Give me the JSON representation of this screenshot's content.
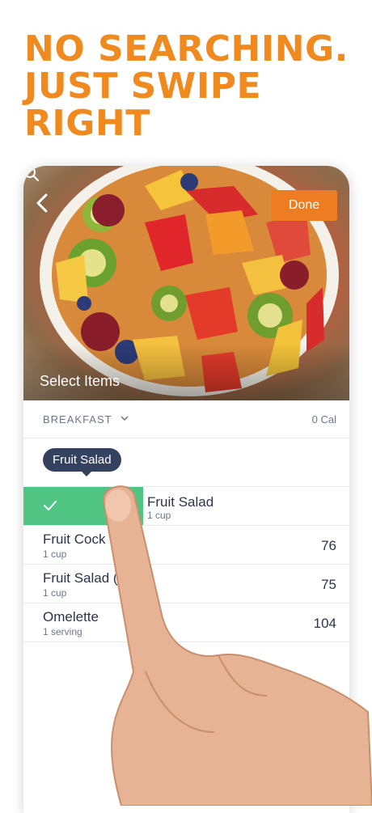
{
  "headline": {
    "line1": "NO SEARCHING.",
    "line2": "JUST SWIPE",
    "line3": "RIGHT",
    "color": "#f08a1f"
  },
  "hero": {
    "back_icon": "chevron-left-icon",
    "done_label": "Done",
    "caption": "Select Items",
    "search_icon": "search-icon"
  },
  "meal": {
    "name": "BREAKFAST",
    "calories": "0 Cal"
  },
  "tooltip": "Fruit Salad",
  "swiped_item": {
    "name": "Fruit Salad",
    "serving": "1 cup",
    "accent": "#50c482"
  },
  "foods": [
    {
      "name": "Fruit Cock",
      "serving": "1 cup",
      "calories": "76"
    },
    {
      "name": "Fruit Salad (a",
      "serving": "1 cup",
      "calories": "75"
    },
    {
      "name": "Omelette",
      "serving": "1 serving",
      "calories": "104"
    }
  ],
  "colors": {
    "accent_orange": "#ee7d22",
    "tooltip_bg": "#34415f",
    "text_dark": "#2d3447",
    "text_muted": "#6d7689"
  }
}
